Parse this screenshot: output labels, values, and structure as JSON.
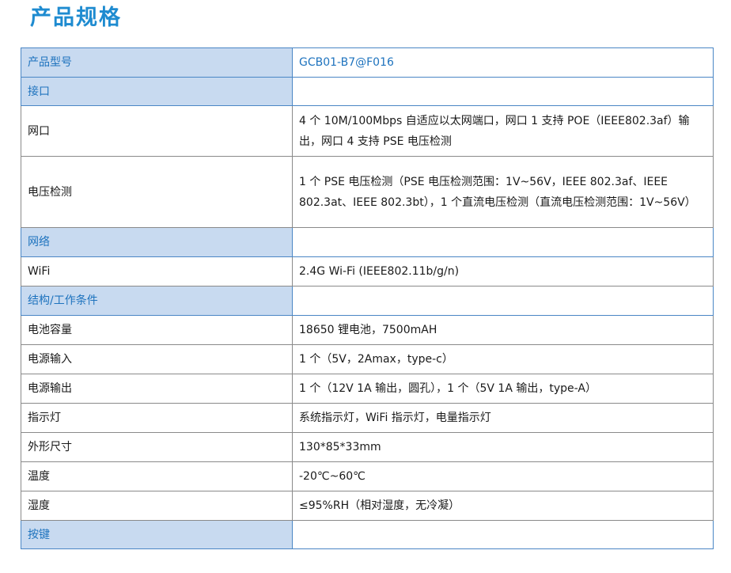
{
  "title": "产品规格",
  "rows": [
    {
      "type": "header",
      "label": "产品型号",
      "value": "GCB01-B7@F016"
    },
    {
      "type": "header",
      "label": "接口",
      "value": ""
    },
    {
      "type": "data",
      "label": "网口",
      "value": "4 个 10M/100Mbps 自适应以太网端口，网口 1 支持 POE（IEEE802.3af）输出，网口 4 支持 PSE 电压检测"
    },
    {
      "type": "data",
      "label": "电压检测",
      "value": "1 个 PSE 电压检测（PSE 电压检测范围：1V~56V，IEEE 802.3af、IEEE 802.3at、IEEE 802.3bt），1 个直流电压检测（直流电压检测范围：1V~56V）"
    },
    {
      "type": "header",
      "label": "网络",
      "value": ""
    },
    {
      "type": "data",
      "label": "WiFi",
      "value": "2.4G Wi-Fi (IEEE802.11b/g/n)"
    },
    {
      "type": "header",
      "label": "结构/工作条件",
      "value": ""
    },
    {
      "type": "data",
      "label": "电池容量",
      "value": "18650 锂电池，7500mAH"
    },
    {
      "type": "data",
      "label": "电源输入",
      "value": "1 个（5V，2Amax，type-c）"
    },
    {
      "type": "data",
      "label": "电源输出",
      "value": "1 个（12V 1A 输出，圆孔），1 个（5V 1A 输出，type-A）"
    },
    {
      "type": "data",
      "label": "指示灯",
      "value": "系统指示灯，WiFi 指示灯，电量指示灯"
    },
    {
      "type": "data",
      "label": "外形尺寸",
      "value": "130*85*33mm"
    },
    {
      "type": "data",
      "label": "温度",
      "value": "-20℃~60℃"
    },
    {
      "type": "data",
      "label": "湿度",
      "value": "≤95%RH（相对湿度，无冷凝）"
    },
    {
      "type": "header",
      "label": "按键",
      "value": ""
    }
  ]
}
